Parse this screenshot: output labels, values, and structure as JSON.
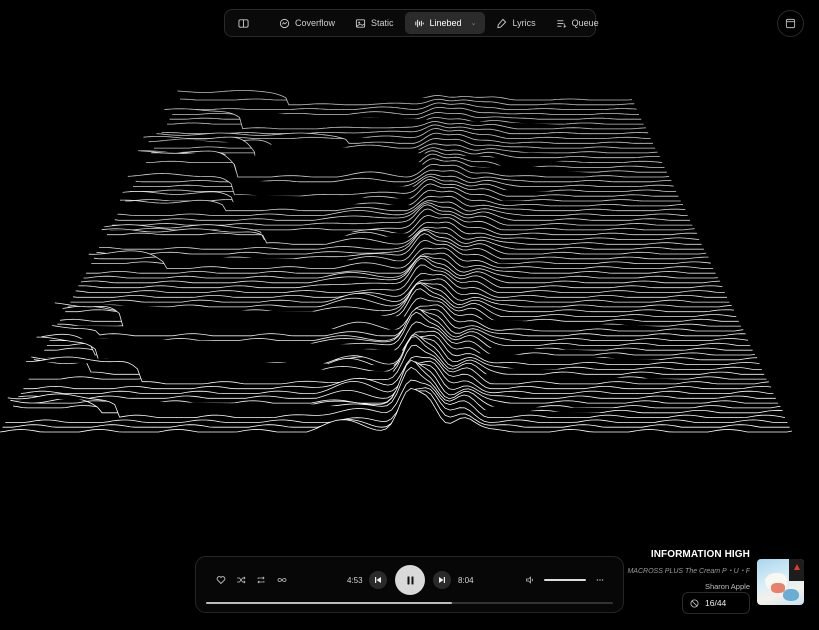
{
  "toolbar": {
    "tabs": [
      {
        "label": "Coverflow",
        "icon": "coverflow-icon"
      },
      {
        "label": "Static",
        "icon": "image-icon"
      },
      {
        "label": "Linebed",
        "icon": "waveform-icon",
        "active": true
      },
      {
        "label": "Lyrics",
        "icon": "mic-icon"
      },
      {
        "label": "Queue",
        "icon": "queue-icon"
      }
    ]
  },
  "player": {
    "elapsed": "4:53",
    "duration": "8:04",
    "progress_fraction": 0.605,
    "volume_fraction": 0.95
  },
  "track": {
    "title": "INFORMATION HIGH",
    "album": "MACROSS PLUS The Cream P・U・F",
    "artist": "Sharon Apple",
    "position": "16/44"
  },
  "colors": {
    "background": "#000000",
    "lines": "#ffffff",
    "accent": "#d9d9d9"
  }
}
